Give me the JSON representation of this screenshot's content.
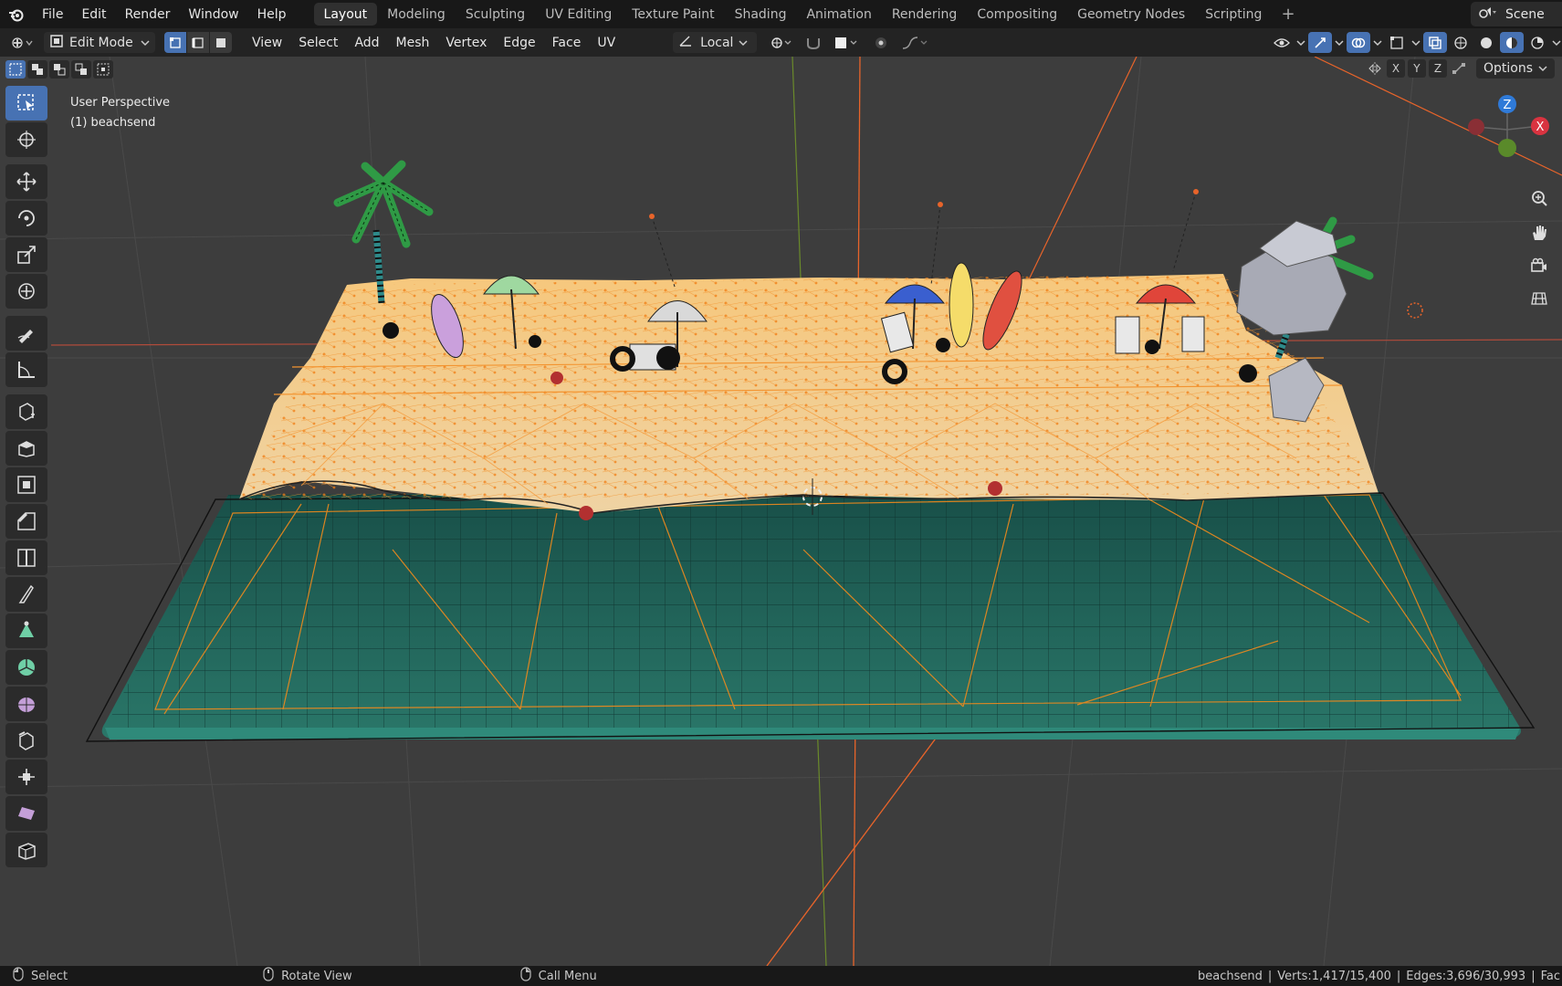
{
  "app": {
    "menus": [
      "File",
      "Edit",
      "Render",
      "Window",
      "Help"
    ],
    "workspaces": [
      "Layout",
      "Modeling",
      "Sculpting",
      "UV Editing",
      "Texture Paint",
      "Shading",
      "Animation",
      "Rendering",
      "Compositing",
      "Geometry Nodes",
      "Scripting"
    ],
    "active_workspace": "Layout",
    "scene_label": "Scene"
  },
  "header": {
    "mode": "Edit Mode",
    "menus": [
      "View",
      "Select",
      "Add",
      "Mesh",
      "Vertex",
      "Edge",
      "Face",
      "UV"
    ],
    "transform_orientation": "Local"
  },
  "viewport": {
    "perspective_label": "User Perspective",
    "object_label": "(1) beachsend",
    "options_label": "Options",
    "mirror_axes": [
      "X",
      "Y",
      "Z"
    ],
    "gizmo_axes": {
      "z": "Z",
      "x": "X"
    },
    "colors": {
      "sand": "#f0c98a",
      "sand_edges": "#f08a1c",
      "water": "#1f6b5e",
      "background": "#3d3d3d",
      "selection_blue": "#4772b3"
    }
  },
  "toolbar": {
    "tools": [
      "select-box-icon",
      "cursor-icon",
      "move-icon",
      "rotate-icon",
      "scale-icon",
      "transform-icon",
      "annotate-icon",
      "measure-icon",
      "add-cube-icon",
      "extrude-icon",
      "inset-icon",
      "bevel-icon",
      "loop-cut-icon",
      "knife-icon",
      "poly-build-icon",
      "spin-icon",
      "smooth-icon",
      "edge-slide-icon",
      "shrink-fatten-icon",
      "shear-icon",
      "rip-icon"
    ]
  },
  "statusbar": {
    "left_click": "Select",
    "middle_click": "Rotate View",
    "right_click": "Call Menu",
    "object_name": "beachsend",
    "verts": "Verts:1,417/15,400",
    "edges": "Edges:3,696/30,993",
    "faces": "Fac"
  }
}
